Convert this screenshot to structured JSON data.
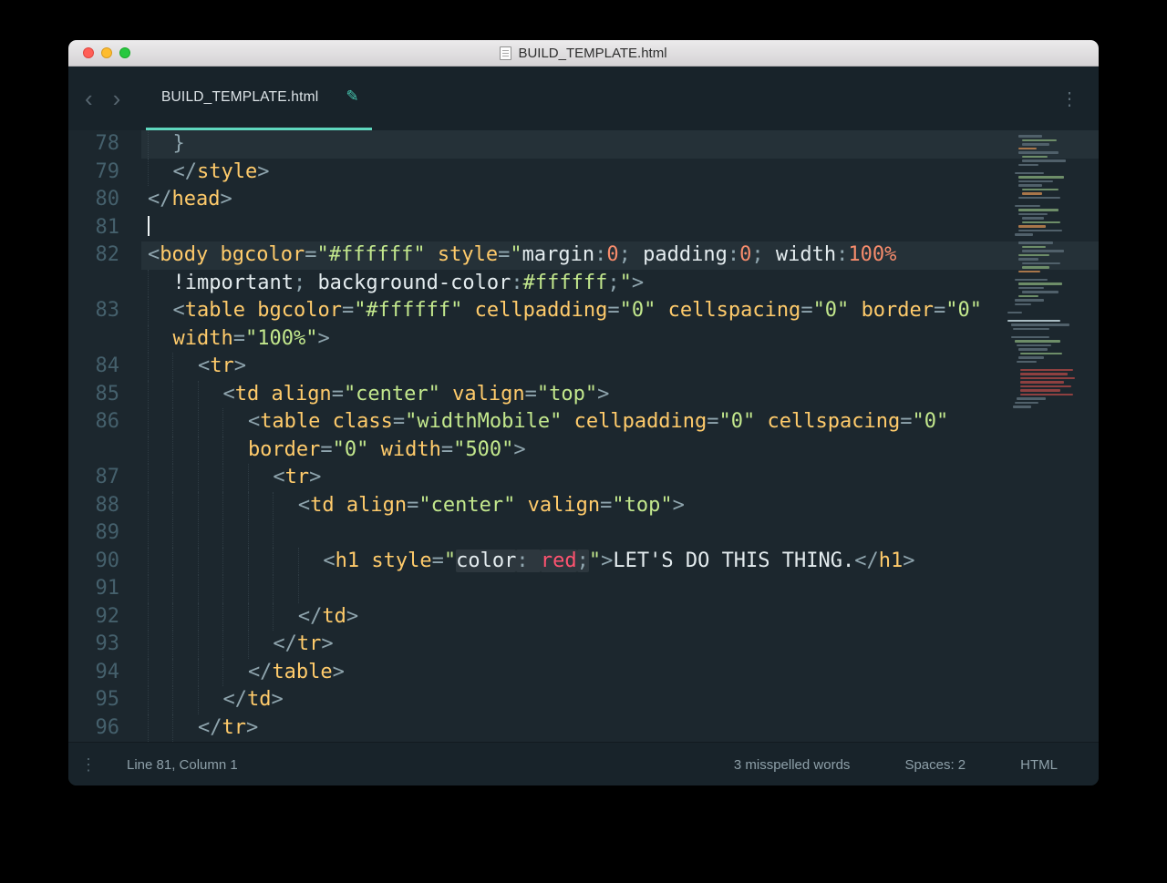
{
  "window": {
    "title": "BUILD_TEMPLATE.html"
  },
  "tabbar": {
    "back": "‹",
    "forward": "›",
    "tab": {
      "label": "BUILD_TEMPLATE.html",
      "dirty_icon": "✎"
    },
    "overflow_icon": "⋮"
  },
  "editor": {
    "lines": [
      {
        "num": "78",
        "indent": 2,
        "hl": true,
        "tokens": [
          [
            "p",
            "}"
          ]
        ]
      },
      {
        "num": "79",
        "indent": 2,
        "tokens": [
          [
            "p",
            "</"
          ],
          [
            "t",
            "style"
          ],
          [
            "p",
            ">"
          ]
        ]
      },
      {
        "num": "80",
        "indent": 0,
        "tokens": [
          [
            "p",
            "</"
          ],
          [
            "t",
            "head"
          ],
          [
            "p",
            ">"
          ]
        ]
      },
      {
        "num": "81",
        "indent": 0,
        "cursor": true,
        "tokens": []
      },
      {
        "num": "82",
        "indent": 0,
        "hl": true,
        "tokens": [
          [
            "p",
            "<"
          ],
          [
            "t",
            "body"
          ],
          [
            "w",
            " "
          ],
          [
            "a",
            "bgcolor"
          ],
          [
            "p",
            "="
          ],
          [
            "s",
            "\"#ffffff\""
          ],
          [
            "w",
            " "
          ],
          [
            "a",
            "style"
          ],
          [
            "p",
            "="
          ],
          [
            "s",
            "\""
          ],
          [
            "c",
            "margin"
          ],
          [
            "p",
            ":"
          ],
          [
            "n",
            "0"
          ],
          [
            "p",
            "; "
          ],
          [
            "c",
            "padding"
          ],
          [
            "p",
            ":"
          ],
          [
            "n",
            "0"
          ],
          [
            "p",
            "; "
          ],
          [
            "c",
            "width"
          ],
          [
            "p",
            ":"
          ],
          [
            "n",
            "100%"
          ]
        ]
      },
      {
        "num": "",
        "indent": 2,
        "tokens": [
          [
            "c",
            "!important"
          ],
          [
            "p",
            "; "
          ],
          [
            "c",
            "background-color"
          ],
          [
            "p",
            ":"
          ],
          [
            "s",
            "#ffffff"
          ],
          [
            "p",
            ";"
          ],
          [
            "s",
            "\""
          ],
          [
            "p",
            ">"
          ]
        ]
      },
      {
        "num": "83",
        "indent": 2,
        "tokens": [
          [
            "p",
            "<"
          ],
          [
            "t",
            "table"
          ],
          [
            "w",
            " "
          ],
          [
            "a",
            "bgcolor"
          ],
          [
            "p",
            "="
          ],
          [
            "s",
            "\"#ffffff\""
          ],
          [
            "w",
            " "
          ],
          [
            "a",
            "cellpadding"
          ],
          [
            "p",
            "="
          ],
          [
            "s",
            "\"0\""
          ],
          [
            "w",
            " "
          ],
          [
            "a",
            "cellspacing"
          ],
          [
            "p",
            "="
          ],
          [
            "s",
            "\"0\""
          ],
          [
            "w",
            " "
          ],
          [
            "a",
            "border"
          ],
          [
            "p",
            "="
          ],
          [
            "s",
            "\"0\""
          ]
        ]
      },
      {
        "num": "",
        "indent": 2,
        "tokens": [
          [
            "a",
            "width"
          ],
          [
            "p",
            "="
          ],
          [
            "s",
            "\"100%\""
          ],
          [
            "p",
            ">"
          ]
        ]
      },
      {
        "num": "84",
        "indent": 4,
        "tokens": [
          [
            "p",
            "<"
          ],
          [
            "t",
            "tr"
          ],
          [
            "p",
            ">"
          ]
        ]
      },
      {
        "num": "85",
        "indent": 6,
        "tokens": [
          [
            "p",
            "<"
          ],
          [
            "t",
            "td"
          ],
          [
            "w",
            " "
          ],
          [
            "a",
            "align"
          ],
          [
            "p",
            "="
          ],
          [
            "s",
            "\"center\""
          ],
          [
            "w",
            " "
          ],
          [
            "a",
            "valign"
          ],
          [
            "p",
            "="
          ],
          [
            "s",
            "\"top\""
          ],
          [
            "p",
            ">"
          ]
        ]
      },
      {
        "num": "86",
        "indent": 8,
        "tokens": [
          [
            "p",
            "<"
          ],
          [
            "t",
            "table"
          ],
          [
            "w",
            " "
          ],
          [
            "a",
            "class"
          ],
          [
            "p",
            "="
          ],
          [
            "s",
            "\"widthMobile\""
          ],
          [
            "w",
            " "
          ],
          [
            "a",
            "cellpadding"
          ],
          [
            "p",
            "="
          ],
          [
            "s",
            "\"0\""
          ],
          [
            "w",
            " "
          ],
          [
            "a",
            "cellspacing"
          ],
          [
            "p",
            "="
          ],
          [
            "s",
            "\"0\""
          ]
        ]
      },
      {
        "num": "",
        "indent": 8,
        "tokens": [
          [
            "a",
            "border"
          ],
          [
            "p",
            "="
          ],
          [
            "s",
            "\"0\""
          ],
          [
            "w",
            " "
          ],
          [
            "a",
            "width"
          ],
          [
            "p",
            "="
          ],
          [
            "s",
            "\"500\""
          ],
          [
            "p",
            ">"
          ]
        ]
      },
      {
        "num": "87",
        "indent": 10,
        "tokens": [
          [
            "p",
            "<"
          ],
          [
            "t",
            "tr"
          ],
          [
            "p",
            ">"
          ]
        ]
      },
      {
        "num": "88",
        "indent": 12,
        "tokens": [
          [
            "p",
            "<"
          ],
          [
            "t",
            "td"
          ],
          [
            "w",
            " "
          ],
          [
            "a",
            "align"
          ],
          [
            "p",
            "="
          ],
          [
            "s",
            "\"center\""
          ],
          [
            "w",
            " "
          ],
          [
            "a",
            "valign"
          ],
          [
            "p",
            "="
          ],
          [
            "s",
            "\"top\""
          ],
          [
            "p",
            ">"
          ]
        ]
      },
      {
        "num": "89",
        "indent": 12,
        "tokens": []
      },
      {
        "num": "90",
        "indent": 14,
        "tokens": [
          [
            "p",
            "<"
          ],
          [
            "t",
            "h1"
          ],
          [
            "w",
            " "
          ],
          [
            "a",
            "style"
          ],
          [
            "p",
            "="
          ],
          [
            "s",
            "\""
          ],
          [
            "c",
            "color",
            1
          ],
          [
            "p",
            ": ",
            1
          ],
          [
            "r",
            "red",
            1
          ],
          [
            "p",
            ";",
            1
          ],
          [
            "s",
            "\""
          ],
          [
            "p",
            ">"
          ],
          [
            "w",
            "LET'S DO THIS THING."
          ],
          [
            "p",
            "</"
          ],
          [
            "t",
            "h1"
          ],
          [
            "p",
            ">"
          ]
        ]
      },
      {
        "num": "91",
        "indent": 14,
        "tokens": []
      },
      {
        "num": "92",
        "indent": 12,
        "tokens": [
          [
            "p",
            "</"
          ],
          [
            "t",
            "td"
          ],
          [
            "p",
            ">"
          ]
        ]
      },
      {
        "num": "93",
        "indent": 10,
        "tokens": [
          [
            "p",
            "</"
          ],
          [
            "t",
            "tr"
          ],
          [
            "p",
            ">"
          ]
        ]
      },
      {
        "num": "94",
        "indent": 8,
        "tokens": [
          [
            "p",
            "</"
          ],
          [
            "t",
            "table"
          ],
          [
            "p",
            ">"
          ]
        ]
      },
      {
        "num": "95",
        "indent": 6,
        "tokens": [
          [
            "p",
            "</"
          ],
          [
            "t",
            "td"
          ],
          [
            "p",
            ">"
          ]
        ]
      },
      {
        "num": "96",
        "indent": 4,
        "tokens": [
          [
            "p",
            "</"
          ],
          [
            "t",
            "tr"
          ],
          [
            "p",
            ">"
          ]
        ]
      }
    ]
  },
  "minimap": {
    "rows": [
      [
        12,
        26,
        "g"
      ],
      [
        16,
        38,
        "G"
      ],
      [
        16,
        30,
        "g"
      ],
      [
        12,
        20,
        "o"
      ],
      [
        12,
        44,
        "g"
      ],
      [
        16,
        28,
        "G"
      ],
      [
        16,
        48,
        "g"
      ],
      [
        12,
        22,
        "g"
      ],
      null,
      [
        8,
        32,
        "g"
      ],
      [
        12,
        50,
        "G"
      ],
      [
        12,
        38,
        "g"
      ],
      [
        12,
        26,
        "g"
      ],
      [
        16,
        40,
        "G"
      ],
      [
        16,
        22,
        "o"
      ],
      [
        12,
        46,
        "g"
      ],
      null,
      [
        8,
        28,
        "g"
      ],
      [
        12,
        44,
        "G"
      ],
      [
        12,
        32,
        "g"
      ],
      [
        16,
        24,
        "g"
      ],
      [
        16,
        42,
        "G"
      ],
      [
        12,
        30,
        "o"
      ],
      [
        12,
        48,
        "g"
      ],
      [
        8,
        20,
        "g"
      ],
      null,
      [
        12,
        38,
        "g"
      ],
      [
        16,
        26,
        "G"
      ],
      [
        16,
        46,
        "g"
      ],
      [
        12,
        34,
        "G"
      ],
      [
        12,
        22,
        "g"
      ],
      [
        16,
        42,
        "g"
      ],
      [
        16,
        30,
        "G"
      ],
      [
        12,
        24,
        "o"
      ],
      null,
      [
        8,
        36,
        "g"
      ],
      [
        12,
        48,
        "G"
      ],
      [
        12,
        28,
        "g"
      ],
      [
        16,
        40,
        "g"
      ],
      [
        12,
        22,
        "G"
      ],
      [
        8,
        32,
        "g"
      ],
      [
        8,
        18,
        "g"
      ],
      null,
      [
        0,
        16,
        "g"
      ],
      null,
      [
        0,
        58,
        "w"
      ],
      [
        4,
        64,
        "g"
      ],
      [
        6,
        40,
        "g"
      ],
      null,
      [
        4,
        42,
        "g"
      ],
      [
        8,
        50,
        "G"
      ],
      [
        10,
        38,
        "g"
      ],
      [
        12,
        32,
        "g"
      ],
      [
        14,
        46,
        "G"
      ],
      [
        12,
        28,
        "g"
      ],
      [
        10,
        22,
        "g"
      ],
      null,
      [
        14,
        58,
        "r"
      ],
      [
        14,
        52,
        "r"
      ],
      [
        14,
        60,
        "r"
      ],
      [
        14,
        48,
        "r"
      ],
      [
        14,
        56,
        "r"
      ],
      [
        14,
        44,
        "r"
      ],
      [
        14,
        58,
        "r"
      ],
      [
        10,
        32,
        "g"
      ],
      [
        8,
        26,
        "g"
      ],
      [
        6,
        20,
        "g"
      ]
    ]
  },
  "statusbar": {
    "menu_icon": "⋮",
    "position": "Line 81, Column 1",
    "spell": "3 misspelled words",
    "spaces": "Spaces: 2",
    "syntax": "HTML"
  },
  "colors": {
    "accent_teal": "#5fd7be",
    "editor_bg": "#1c272e",
    "chrome_bg": "#18232a",
    "traffic_close": "#ff5f57",
    "traffic_minimize": "#febc2e",
    "traffic_zoom": "#28c840",
    "tag": "#ffcb6b",
    "string": "#c3e88d",
    "number": "#f78c6c",
    "red_value": "#ff5370",
    "punctuation": "#8fa5ae",
    "line_number": "#45606c"
  }
}
